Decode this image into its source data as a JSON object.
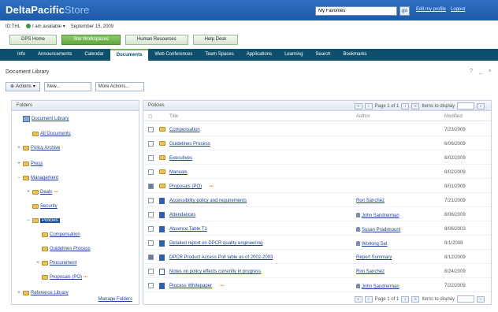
{
  "app": {
    "brand": "DeltaPacific",
    "brand_suffix": "Store"
  },
  "search": {
    "value": "My Favorites",
    "go_label": "go"
  },
  "top_links": [
    "Edit my profile",
    "Logout"
  ],
  "status": {
    "id": "ID:THL",
    "presence": "I am available",
    "date": "September 15, 2009"
  },
  "area_tabs": [
    {
      "label": "DPS Home",
      "active": false
    },
    {
      "label": "Site Workspaces",
      "active": true
    },
    {
      "label": "Human Resources",
      "active": false
    },
    {
      "label": "Help Desk",
      "active": false
    }
  ],
  "nav": [
    {
      "label": "Info",
      "active": false
    },
    {
      "label": "Announcements",
      "active": false
    },
    {
      "label": "Calendar",
      "active": false
    },
    {
      "label": "Documents",
      "active": true
    },
    {
      "label": "Web Conferences",
      "active": false
    },
    {
      "label": "Team Spaces",
      "active": false
    },
    {
      "label": "Applications",
      "active": false
    },
    {
      "label": "Learning",
      "active": false
    },
    {
      "label": "Search",
      "active": false
    },
    {
      "label": "Bookmarks",
      "active": false
    }
  ],
  "library": {
    "title": "Document Library",
    "titlebar_icons": "? _ ×",
    "add_button": "Actions",
    "new_select": "New...",
    "actions_select": "More Actions..."
  },
  "folders_panel": {
    "heading": "Folders",
    "manage_label": "Manage Folders",
    "items": [
      {
        "label": "Document Library",
        "expand": "",
        "level": 0,
        "type": "library",
        "new": false,
        "selected": false
      },
      {
        "label": "All Documents",
        "expand": "",
        "level": 1,
        "type": "folder",
        "new": false,
        "selected": false
      },
      {
        "label": "Policy Archive",
        "expand": "+",
        "level": 0,
        "type": "folder",
        "new": false,
        "selected": false
      },
      {
        "label": "Press",
        "expand": "+",
        "level": 0,
        "type": "folder",
        "new": false,
        "selected": false
      },
      {
        "label": "Management",
        "expand": "−",
        "level": 0,
        "type": "folder",
        "new": false,
        "selected": false
      },
      {
        "label": "Deals",
        "expand": "+",
        "level": 1,
        "type": "folder",
        "new": true,
        "selected": false
      },
      {
        "label": "Security",
        "expand": "",
        "level": 1,
        "type": "folder",
        "new": false,
        "selected": false
      },
      {
        "label": "Policies",
        "expand": "−",
        "level": 1,
        "type": "folder",
        "new": false,
        "selected": true
      },
      {
        "label": "Compensation",
        "expand": "",
        "level": 2,
        "type": "folder",
        "new": false,
        "selected": false
      },
      {
        "label": "Guidelines Process",
        "expand": "",
        "level": 2,
        "type": "folder",
        "new": false,
        "selected": false
      },
      {
        "label": "Procurement",
        "expand": "+",
        "level": 2,
        "type": "folder",
        "new": false,
        "selected": false
      },
      {
        "label": "Proposals (PO)",
        "expand": "",
        "level": 2,
        "type": "folder",
        "new": true,
        "selected": false
      },
      {
        "label": "Reference Library",
        "expand": "+",
        "level": 0,
        "type": "folder",
        "new": false,
        "selected": false
      }
    ]
  },
  "files_panel": {
    "heading": "Policies",
    "pager": {
      "text": "Page 1 of 1",
      "items_per_page_label": "Items to display",
      "items_per_page": ""
    },
    "columns": {
      "title": "Title",
      "author": "Author",
      "modified": "Modified"
    },
    "rows": [
      {
        "name": "Compensation",
        "type": "folder",
        "author": "",
        "date": "7/23/2009",
        "checked": false,
        "new": false
      },
      {
        "name": "Guidelines Process",
        "type": "folder",
        "author": "",
        "date": "6/06/2009",
        "checked": false,
        "new": false
      },
      {
        "name": "Executives",
        "type": "folder",
        "author": "",
        "date": "6/02/2009",
        "checked": false,
        "new": false
      },
      {
        "name": "Manuals",
        "type": "folder",
        "author": "",
        "date": "6/02/2009",
        "checked": false,
        "new": false
      },
      {
        "name": "Proposals (PO)",
        "type": "folder",
        "author": "",
        "date": "8/01/2009",
        "checked": true,
        "new": true
      },
      {
        "name": "Accessibility policy and requirements",
        "type": "doc",
        "author": "Ron Sanchez",
        "author_icon": false,
        "date": "7/21/2009",
        "checked": false,
        "new": false
      },
      {
        "name": "Attendances",
        "type": "doc",
        "author": "John Sandrerman",
        "author_icon": true,
        "date": "8/06/2009",
        "checked": false,
        "new": false
      },
      {
        "name": "Absence Table T1",
        "type": "doc",
        "author": "Susan Pradimount",
        "author_icon": true,
        "date": "8/06/2003",
        "checked": false,
        "new": false
      },
      {
        "name": "Detailed report on DPCR quality engineering",
        "type": "doc",
        "author": "Working Set",
        "author_icon": true,
        "date": "8/1/2009",
        "checked": false,
        "new": false
      },
      {
        "name": "DPCR Product Access Poll table as of 2002-2003",
        "type": "doc",
        "author": "Report Summary",
        "author_icon": false,
        "date": "8/12/2009",
        "checked": true,
        "new": false
      },
      {
        "name": "Notes on policy effects currently in progress",
        "type": "word",
        "author": "Ron Sanchez",
        "author_icon": false,
        "date": "8/24/2009",
        "checked": false,
        "new": false
      },
      {
        "name": "Process Whitepaper",
        "type": "doc",
        "author": "John Sandrerman",
        "author_icon": true,
        "date": "7/22/2009",
        "checked": false,
        "new": true
      }
    ]
  }
}
